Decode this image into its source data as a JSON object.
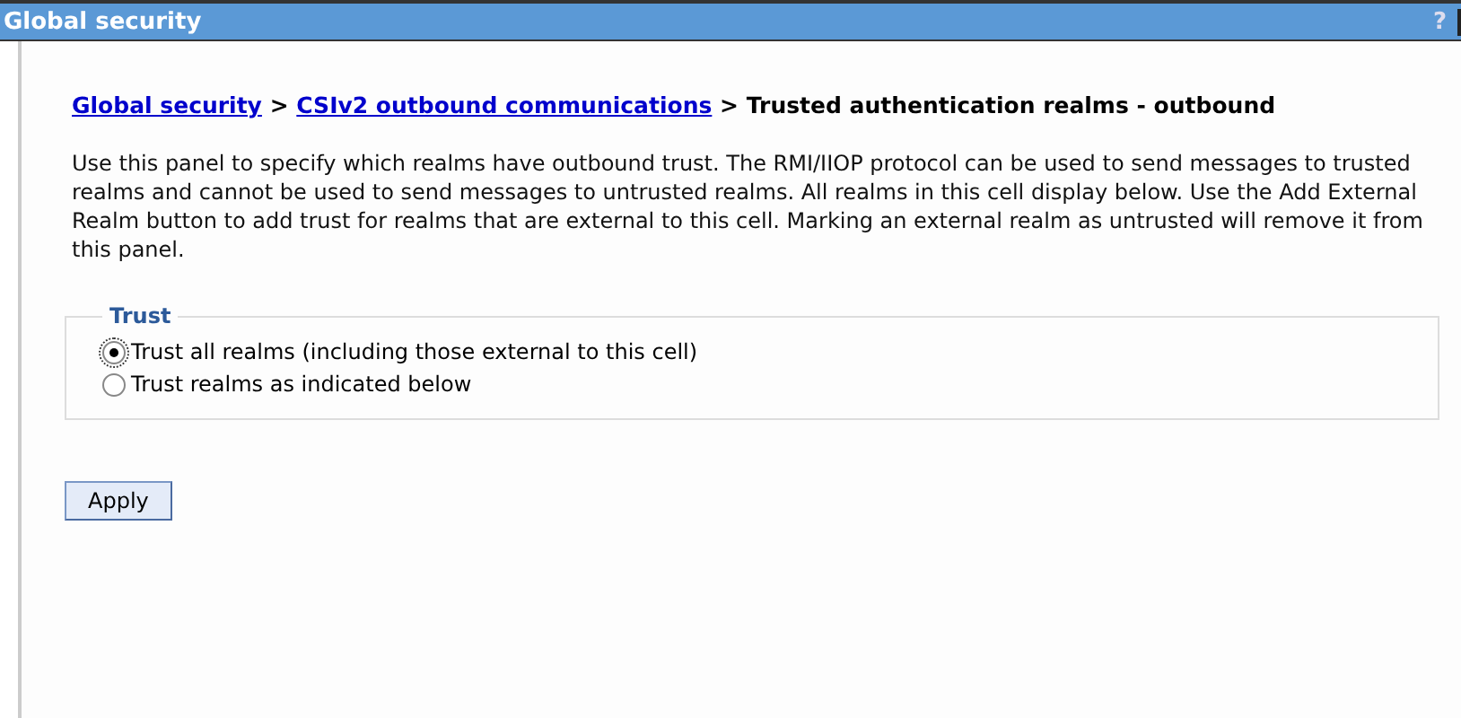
{
  "window": {
    "title": "Global security",
    "help": "?"
  },
  "breadcrumb": {
    "links": [
      "Global security",
      "CSIv2 outbound communications"
    ],
    "separator": ">",
    "current": "Trusted authentication realms - outbound"
  },
  "description": "Use this panel to specify which realms have outbound trust. The RMI/IIOP protocol can be used to send messages to trusted realms and cannot be used to send messages to untrusted realms. All realms in this cell display below. Use the Add External Realm button to add trust for realms that are external to this cell. Marking an external realm as untrusted will remove it from this panel.",
  "trust": {
    "legend": "Trust",
    "options": [
      {
        "label": "Trust all realms (including those external to this cell)",
        "selected": true
      },
      {
        "label": "Trust realms as indicated below",
        "selected": false
      }
    ]
  },
  "buttons": [
    "Apply"
  ]
}
